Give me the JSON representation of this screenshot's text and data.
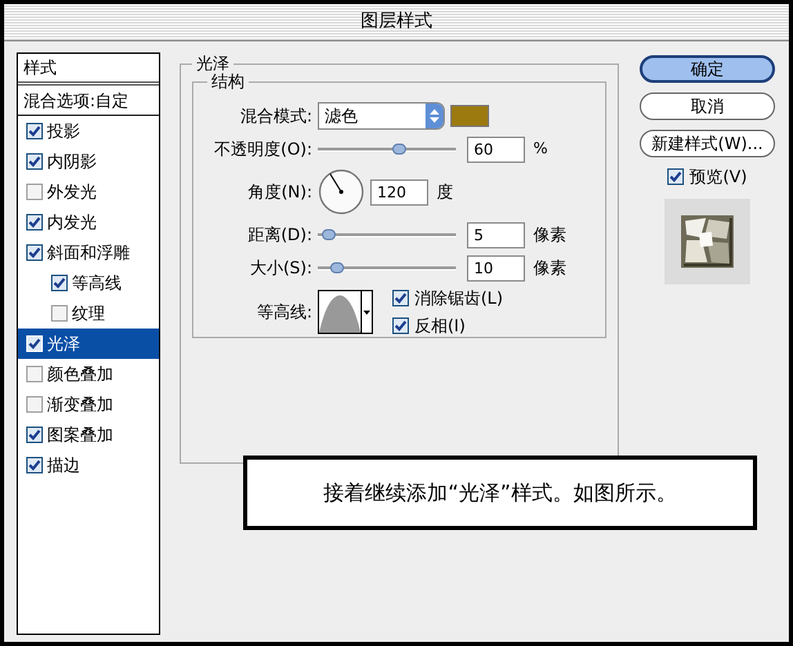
{
  "window": {
    "title": "图层样式"
  },
  "sidebar": {
    "header": "样式",
    "blend_options": "混合选项:自定",
    "items": [
      {
        "label": "投影",
        "checked": true,
        "selected": false
      },
      {
        "label": "内阴影",
        "checked": true,
        "selected": false
      },
      {
        "label": "外发光",
        "checked": false,
        "selected": false
      },
      {
        "label": "内发光",
        "checked": true,
        "selected": false
      },
      {
        "label": "斜面和浮雕",
        "checked": true,
        "selected": false,
        "children": [
          {
            "label": "等高线",
            "checked": true,
            "selected": false
          },
          {
            "label": "纹理",
            "checked": false,
            "selected": false
          }
        ]
      },
      {
        "label": "光泽",
        "checked": true,
        "selected": true
      },
      {
        "label": "颜色叠加",
        "checked": false,
        "selected": false
      },
      {
        "label": "渐变叠加",
        "checked": false,
        "selected": false
      },
      {
        "label": "图案叠加",
        "checked": true,
        "selected": false
      },
      {
        "label": "描边",
        "checked": true,
        "selected": false
      }
    ]
  },
  "panel": {
    "title": "光泽",
    "group_title": "结构",
    "blend_mode": {
      "label": "混合模式:",
      "value": "滤色",
      "color": "#9c7a10"
    },
    "opacity": {
      "label": "不透明度(O):",
      "level": 0.6,
      "value": "60",
      "unit": "%"
    },
    "angle": {
      "label": "角度(N):",
      "value": "120",
      "unit": "度"
    },
    "distance": {
      "label": "距离(D):",
      "level": 0.03,
      "value": "5",
      "unit": "像素"
    },
    "size": {
      "label": "大小(S):",
      "level": 0.1,
      "value": "10",
      "unit": "像素"
    },
    "contour": {
      "label": "等高线:"
    },
    "options": [
      {
        "label": "消除锯齿(L)",
        "checked": true
      },
      {
        "label": "反相(I)",
        "checked": true
      }
    ]
  },
  "buttons": [
    {
      "label": "确定",
      "selected": true
    },
    {
      "label": "取消",
      "selected": false
    },
    {
      "label": "新建样式(W)...",
      "selected": false
    }
  ],
  "preview": {
    "label": "预览(V)",
    "checked": true
  },
  "caption": "接着继续添加“光泽”样式。如图所示。"
}
